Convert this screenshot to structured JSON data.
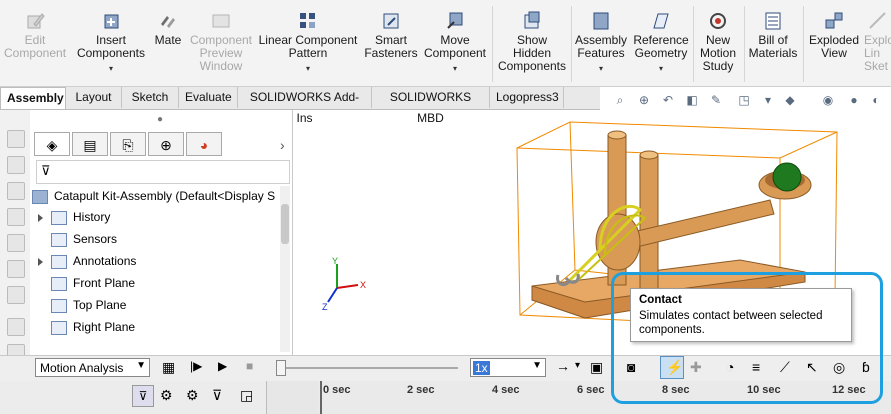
{
  "ribbon": {
    "buttons": [
      {
        "label": "Edit\nComponent",
        "disabled": true,
        "icon": "edit-component-icon"
      },
      {
        "label": "Insert\nComponents",
        "disabled": false,
        "icon": "insert-components-icon",
        "dropdown": "▾"
      },
      {
        "label": "Mate",
        "disabled": false,
        "icon": "mate-icon"
      },
      {
        "label": "Component\nPreview\nWindow",
        "disabled": true,
        "icon": "component-preview-icon"
      },
      {
        "label": "Linear Component\nPattern",
        "disabled": false,
        "icon": "linear-pattern-icon",
        "dropdown": "▾"
      },
      {
        "label": "Smart\nFasteners",
        "disabled": false,
        "icon": "smart-fasteners-icon"
      },
      {
        "label": "Move\nComponent",
        "disabled": false,
        "icon": "move-component-icon",
        "dropdown": "▾"
      },
      {
        "label": "Show\nHidden\nComponents",
        "disabled": false,
        "icon": "show-hidden-icon"
      },
      {
        "label": "Assembly\nFeatures",
        "disabled": false,
        "icon": "assembly-features-icon",
        "dropdown": "▾"
      },
      {
        "label": "Reference\nGeometry",
        "disabled": false,
        "icon": "reference-geometry-icon",
        "dropdown": "▾"
      },
      {
        "label": "New\nMotion\nStudy",
        "disabled": false,
        "icon": "new-motion-study-icon"
      },
      {
        "label": "Bill of\nMaterials",
        "disabled": false,
        "icon": "bill-of-materials-icon"
      },
      {
        "label": "Exploded\nView",
        "disabled": false,
        "icon": "exploded-view-icon"
      },
      {
        "label": "Explo\nLin\nSket",
        "disabled": true,
        "icon": "explode-line-sketch-icon"
      }
    ]
  },
  "tabs": [
    "Assembly",
    "Layout",
    "Sketch",
    "Evaluate",
    "SOLIDWORKS Add-Ins",
    "SOLIDWORKS MBD",
    "Logopress3"
  ],
  "tree": {
    "root": "Catapult Kit-Assembly  (Default<Display S",
    "items": [
      {
        "label": "History",
        "expand": true,
        "icon": "history-icon"
      },
      {
        "label": "Sensors",
        "expand": false,
        "icon": "sensors-icon"
      },
      {
        "label": "Annotations",
        "expand": true,
        "icon": "annotations-icon"
      },
      {
        "label": "Front Plane",
        "expand": false,
        "icon": "plane-icon"
      },
      {
        "label": "Top Plane",
        "expand": false,
        "icon": "plane-icon"
      },
      {
        "label": "Right Plane",
        "expand": false,
        "icon": "plane-icon"
      }
    ]
  },
  "motion": {
    "study_type": "Motion Analysis",
    "speed": "1x",
    "ticks": [
      "0 sec",
      "2 sec",
      "4 sec",
      "6 sec",
      "8 sec",
      "10 sec",
      "12 sec"
    ]
  },
  "tooltip": {
    "title": "Contact",
    "text": "Simulates contact between selected components."
  },
  "axes": {
    "x": "X",
    "y": "Y",
    "z": "Z"
  },
  "colors": {
    "highlight": "#1ea0e0",
    "wood": "#d89a55",
    "bbox": "#f08a00",
    "ball": "#1f7a1f"
  }
}
